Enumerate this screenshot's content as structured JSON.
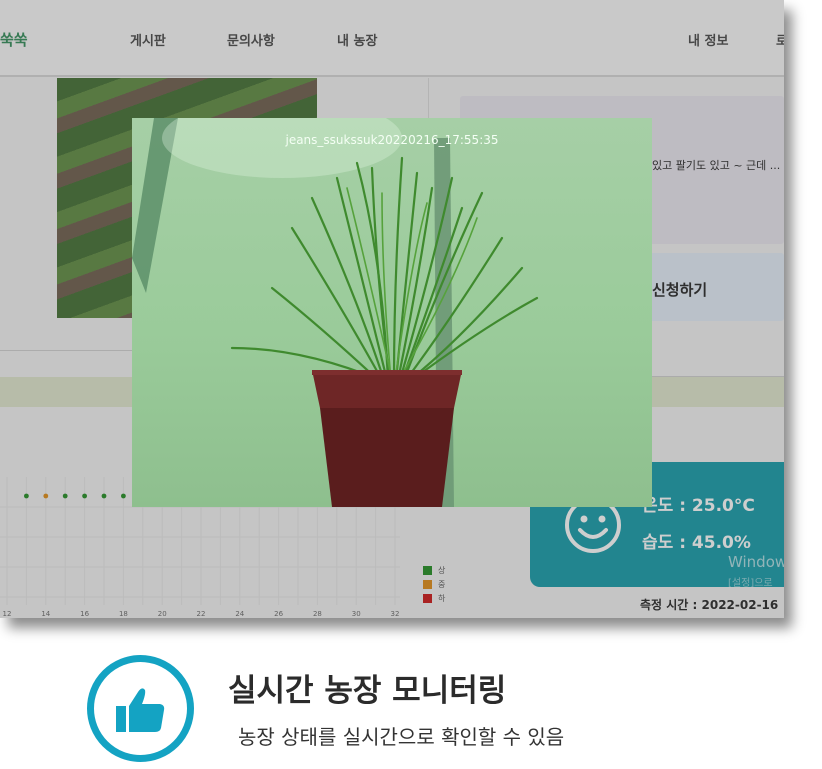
{
  "nav": {
    "logo": "쑥쑥",
    "items": [
      "게시판",
      "문의사항",
      "내 농장",
      "내 정보",
      "로"
    ]
  },
  "dashboard": {
    "post_snippet": "있고 팔기도 있고 ~ 근데 ...",
    "apply_label": "신청하기",
    "chart": {
      "type": "scatter",
      "x_ticks": [
        "12",
        "14",
        "16",
        "18",
        "20",
        "22",
        "24",
        "26",
        "28",
        "30",
        "32"
      ],
      "points": [
        {
          "x": 13,
          "level": "상"
        },
        {
          "x": 14,
          "level": "중"
        },
        {
          "x": 15,
          "level": "상"
        },
        {
          "x": 16,
          "level": "상"
        },
        {
          "x": 17,
          "level": "상"
        },
        {
          "x": 18,
          "level": "상"
        }
      ],
      "legend": [
        {
          "label": "상",
          "color": "#1e8c1e"
        },
        {
          "label": "중",
          "color": "#e08a10"
        },
        {
          "label": "하",
          "color": "#cc1111"
        }
      ]
    },
    "sensor": {
      "temperature": "온도 : 25.0°C",
      "humidity": "습도 : 45.0%",
      "windows_main": "Windows",
      "windows_sub": "[설정]으로",
      "measure_time": "측정 시간 : 2022-02-16"
    }
  },
  "camera": {
    "timestamp": "jeans_ssukssuk20220216_17:55:35"
  },
  "caption": {
    "title": "실시간 농장 모니터링",
    "subtitle": "농장 상태를 실시간으로 확인할 수 있음"
  },
  "colors": {
    "accent": "#14a3c3",
    "sensor_card": "#119aa8",
    "logo": "#2e8b57"
  },
  "icons": [
    "smiley-icon",
    "thumbs-up-icon"
  ]
}
